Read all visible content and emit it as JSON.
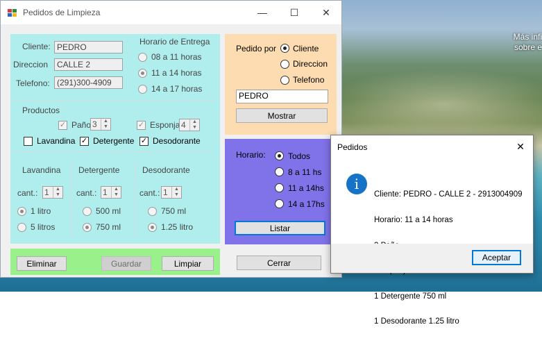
{
  "desktop": {
    "text_line1": "Más infi",
    "text_line2": "sobre e"
  },
  "window": {
    "title": "Pedidos de Limpieza",
    "minimize_glyph": "—",
    "maximize_glyph": "☐",
    "close_glyph": "✕"
  },
  "cliente": {
    "cliente_label": "Cliente:",
    "cliente_value": "PEDRO",
    "direccion_label": "Direccion",
    "direccion_value": "CALLE 2",
    "telefono_label": "Telefono:",
    "telefono_value": "(291)300-4909"
  },
  "horario_entrega": {
    "title": "Horario de Entrega",
    "options": [
      "08 a 11 horas",
      "11 a 14 horas",
      "14 a 17 horas"
    ],
    "selected": "11 a 14 horas"
  },
  "productos": {
    "title": "Productos",
    "pano_label": "Paño",
    "pano_qty": "3",
    "pano_checked": true,
    "esponja_label": "Esponja",
    "esponja_qty": "4",
    "esponja_checked": true,
    "lavandina_label": "Lavandina",
    "lavandina_checked": false,
    "detergente_label": "Detergente",
    "detergente_checked": true,
    "desodorante_label": "Desodorante",
    "desodorante_checked": true
  },
  "lavandina": {
    "title": "Lavandina",
    "cant_label": "cant.:",
    "qty": "1",
    "options": [
      "1 litro",
      "5 litros"
    ],
    "selected": "1 litro"
  },
  "detergente": {
    "title": "Detergente",
    "cant_label": "cant.:",
    "qty": "1",
    "options": [
      "500 ml",
      "750 ml"
    ],
    "selected": "750 ml"
  },
  "desodorante": {
    "title": "Desodorante",
    "cant_label": "cant.:",
    "qty": "1",
    "options": [
      "750 ml",
      "1.25 litro"
    ],
    "selected": "1.25 litro"
  },
  "acciones": {
    "eliminar": "Eliminar",
    "guardar": "Guardar",
    "limpiar": "Limpiar"
  },
  "pedido_por": {
    "title": "Pedido por",
    "options": [
      "Cliente",
      "Direccion",
      "Telefono"
    ],
    "selected": "Cliente",
    "search_value": "PEDRO",
    "mostrar": "Mostrar"
  },
  "horario_filtro": {
    "title": "Horario:",
    "options": [
      "Todos",
      "8 a 11 hs",
      "11 a 14hs",
      "14 a 17hs"
    ],
    "selected": "Todos",
    "listar": "Listar"
  },
  "cerrar": "Cerrar",
  "msgbox": {
    "title": "Pedidos",
    "close_glyph": "✕",
    "icon_glyph": "i",
    "lines": [
      "Cliente: PEDRO - CALLE 2 - 2913004909",
      "Horario: 11 a 14 horas",
      "3 Paño",
      "4 Esponja",
      "1 Detergente 750 ml",
      "1 Desodorante 1.25 litro"
    ],
    "ok": "Aceptar"
  }
}
